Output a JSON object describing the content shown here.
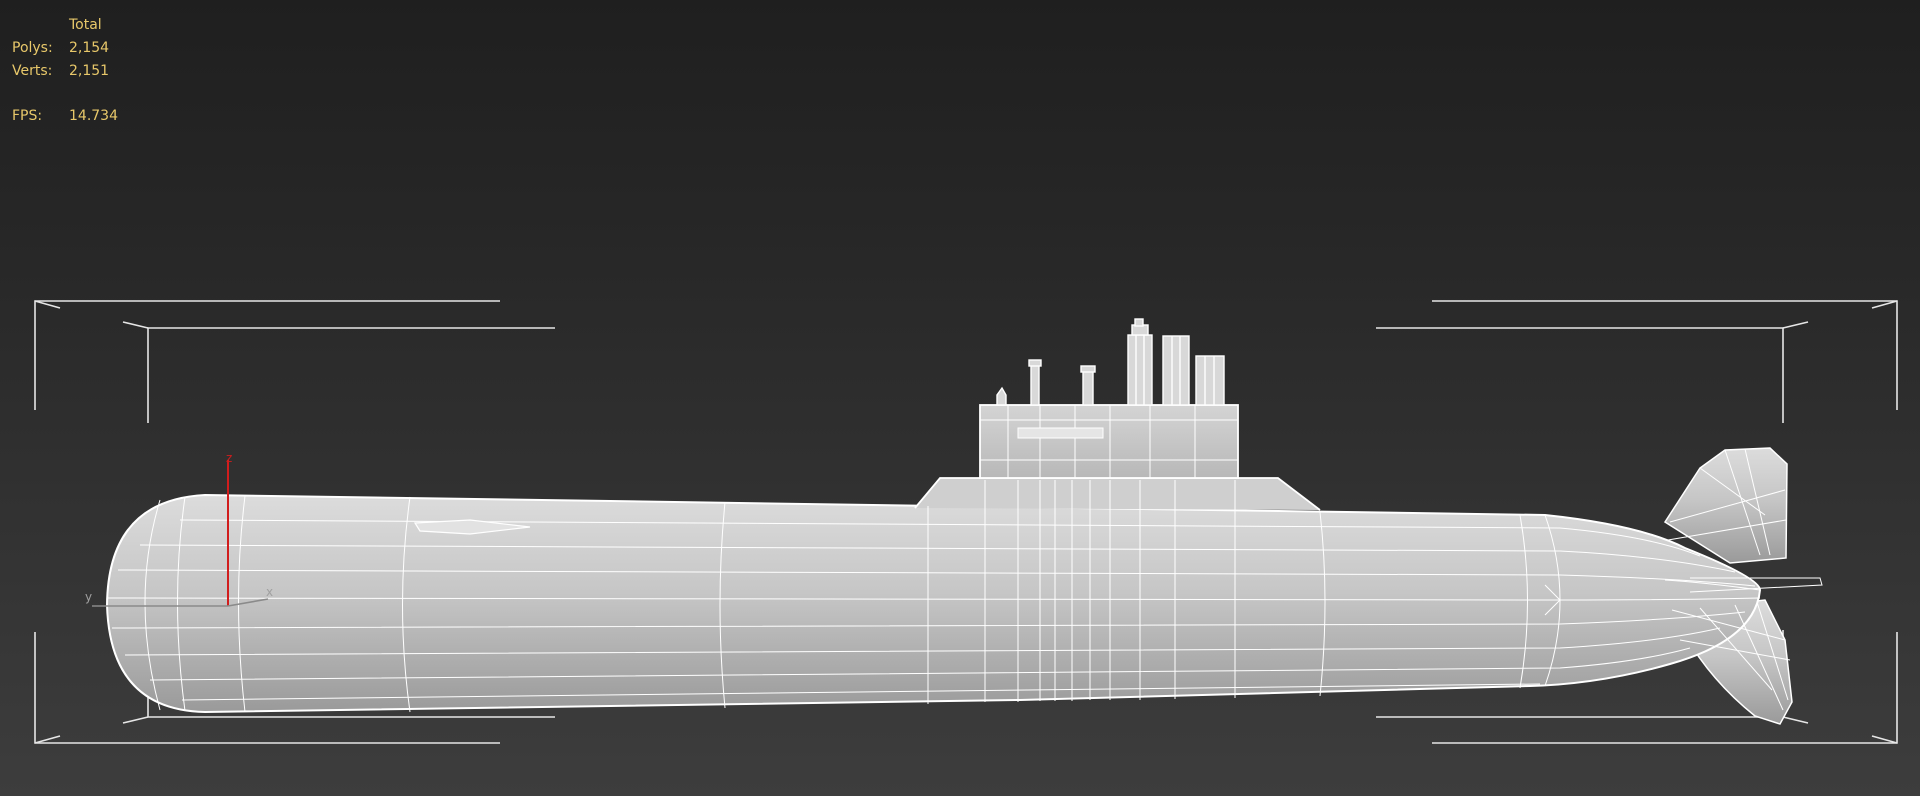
{
  "viewport_stats": {
    "total_header": "Total",
    "polys_label": "Polys:",
    "polys_value": "2,154",
    "verts_label": "Verts:",
    "verts_value": "2,151",
    "fps_label": "FPS:",
    "fps_value": "14.734"
  },
  "axis_gizmo": {
    "z_label": "z",
    "x_label": "x",
    "y_label": "y"
  },
  "colors": {
    "stats_text": "#e8c86a",
    "wire": "#ffffff",
    "hull_fill": "#c9c9c9",
    "z_axis": "#d11d1d",
    "bracket": "#e6e6e6"
  }
}
